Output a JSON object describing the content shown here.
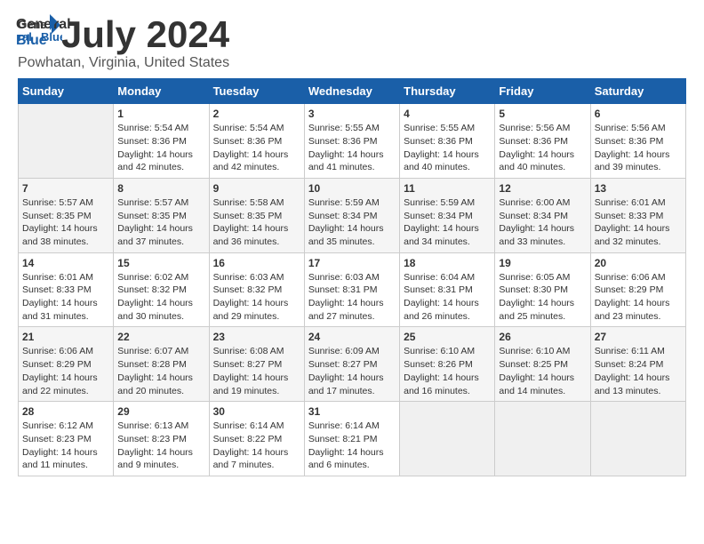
{
  "logo": {
    "general": "General",
    "blue": "Blue"
  },
  "title": "July 2024",
  "subtitle": "Powhatan, Virginia, United States",
  "days_of_week": [
    "Sunday",
    "Monday",
    "Tuesday",
    "Wednesday",
    "Thursday",
    "Friday",
    "Saturday"
  ],
  "weeks": [
    [
      {
        "day": "",
        "empty": true
      },
      {
        "day": "1",
        "sunrise": "Sunrise: 5:54 AM",
        "sunset": "Sunset: 8:36 PM",
        "daylight": "Daylight: 14 hours and 42 minutes."
      },
      {
        "day": "2",
        "sunrise": "Sunrise: 5:54 AM",
        "sunset": "Sunset: 8:36 PM",
        "daylight": "Daylight: 14 hours and 42 minutes."
      },
      {
        "day": "3",
        "sunrise": "Sunrise: 5:55 AM",
        "sunset": "Sunset: 8:36 PM",
        "daylight": "Daylight: 14 hours and 41 minutes."
      },
      {
        "day": "4",
        "sunrise": "Sunrise: 5:55 AM",
        "sunset": "Sunset: 8:36 PM",
        "daylight": "Daylight: 14 hours and 40 minutes."
      },
      {
        "day": "5",
        "sunrise": "Sunrise: 5:56 AM",
        "sunset": "Sunset: 8:36 PM",
        "daylight": "Daylight: 14 hours and 40 minutes."
      },
      {
        "day": "6",
        "sunrise": "Sunrise: 5:56 AM",
        "sunset": "Sunset: 8:36 PM",
        "daylight": "Daylight: 14 hours and 39 minutes."
      }
    ],
    [
      {
        "day": "7",
        "sunrise": "Sunrise: 5:57 AM",
        "sunset": "Sunset: 8:35 PM",
        "daylight": "Daylight: 14 hours and 38 minutes."
      },
      {
        "day": "8",
        "sunrise": "Sunrise: 5:57 AM",
        "sunset": "Sunset: 8:35 PM",
        "daylight": "Daylight: 14 hours and 37 minutes."
      },
      {
        "day": "9",
        "sunrise": "Sunrise: 5:58 AM",
        "sunset": "Sunset: 8:35 PM",
        "daylight": "Daylight: 14 hours and 36 minutes."
      },
      {
        "day": "10",
        "sunrise": "Sunrise: 5:59 AM",
        "sunset": "Sunset: 8:34 PM",
        "daylight": "Daylight: 14 hours and 35 minutes."
      },
      {
        "day": "11",
        "sunrise": "Sunrise: 5:59 AM",
        "sunset": "Sunset: 8:34 PM",
        "daylight": "Daylight: 14 hours and 34 minutes."
      },
      {
        "day": "12",
        "sunrise": "Sunrise: 6:00 AM",
        "sunset": "Sunset: 8:34 PM",
        "daylight": "Daylight: 14 hours and 33 minutes."
      },
      {
        "day": "13",
        "sunrise": "Sunrise: 6:01 AM",
        "sunset": "Sunset: 8:33 PM",
        "daylight": "Daylight: 14 hours and 32 minutes."
      }
    ],
    [
      {
        "day": "14",
        "sunrise": "Sunrise: 6:01 AM",
        "sunset": "Sunset: 8:33 PM",
        "daylight": "Daylight: 14 hours and 31 minutes."
      },
      {
        "day": "15",
        "sunrise": "Sunrise: 6:02 AM",
        "sunset": "Sunset: 8:32 PM",
        "daylight": "Daylight: 14 hours and 30 minutes."
      },
      {
        "day": "16",
        "sunrise": "Sunrise: 6:03 AM",
        "sunset": "Sunset: 8:32 PM",
        "daylight": "Daylight: 14 hours and 29 minutes."
      },
      {
        "day": "17",
        "sunrise": "Sunrise: 6:03 AM",
        "sunset": "Sunset: 8:31 PM",
        "daylight": "Daylight: 14 hours and 27 minutes."
      },
      {
        "day": "18",
        "sunrise": "Sunrise: 6:04 AM",
        "sunset": "Sunset: 8:31 PM",
        "daylight": "Daylight: 14 hours and 26 minutes."
      },
      {
        "day": "19",
        "sunrise": "Sunrise: 6:05 AM",
        "sunset": "Sunset: 8:30 PM",
        "daylight": "Daylight: 14 hours and 25 minutes."
      },
      {
        "day": "20",
        "sunrise": "Sunrise: 6:06 AM",
        "sunset": "Sunset: 8:29 PM",
        "daylight": "Daylight: 14 hours and 23 minutes."
      }
    ],
    [
      {
        "day": "21",
        "sunrise": "Sunrise: 6:06 AM",
        "sunset": "Sunset: 8:29 PM",
        "daylight": "Daylight: 14 hours and 22 minutes."
      },
      {
        "day": "22",
        "sunrise": "Sunrise: 6:07 AM",
        "sunset": "Sunset: 8:28 PM",
        "daylight": "Daylight: 14 hours and 20 minutes."
      },
      {
        "day": "23",
        "sunrise": "Sunrise: 6:08 AM",
        "sunset": "Sunset: 8:27 PM",
        "daylight": "Daylight: 14 hours and 19 minutes."
      },
      {
        "day": "24",
        "sunrise": "Sunrise: 6:09 AM",
        "sunset": "Sunset: 8:27 PM",
        "daylight": "Daylight: 14 hours and 17 minutes."
      },
      {
        "day": "25",
        "sunrise": "Sunrise: 6:10 AM",
        "sunset": "Sunset: 8:26 PM",
        "daylight": "Daylight: 14 hours and 16 minutes."
      },
      {
        "day": "26",
        "sunrise": "Sunrise: 6:10 AM",
        "sunset": "Sunset: 8:25 PM",
        "daylight": "Daylight: 14 hours and 14 minutes."
      },
      {
        "day": "27",
        "sunrise": "Sunrise: 6:11 AM",
        "sunset": "Sunset: 8:24 PM",
        "daylight": "Daylight: 14 hours and 13 minutes."
      }
    ],
    [
      {
        "day": "28",
        "sunrise": "Sunrise: 6:12 AM",
        "sunset": "Sunset: 8:23 PM",
        "daylight": "Daylight: 14 hours and 11 minutes."
      },
      {
        "day": "29",
        "sunrise": "Sunrise: 6:13 AM",
        "sunset": "Sunset: 8:23 PM",
        "daylight": "Daylight: 14 hours and 9 minutes."
      },
      {
        "day": "30",
        "sunrise": "Sunrise: 6:14 AM",
        "sunset": "Sunset: 8:22 PM",
        "daylight": "Daylight: 14 hours and 7 minutes."
      },
      {
        "day": "31",
        "sunrise": "Sunrise: 6:14 AM",
        "sunset": "Sunset: 8:21 PM",
        "daylight": "Daylight: 14 hours and 6 minutes."
      },
      {
        "day": "",
        "empty": true
      },
      {
        "day": "",
        "empty": true
      },
      {
        "day": "",
        "empty": true
      }
    ]
  ]
}
